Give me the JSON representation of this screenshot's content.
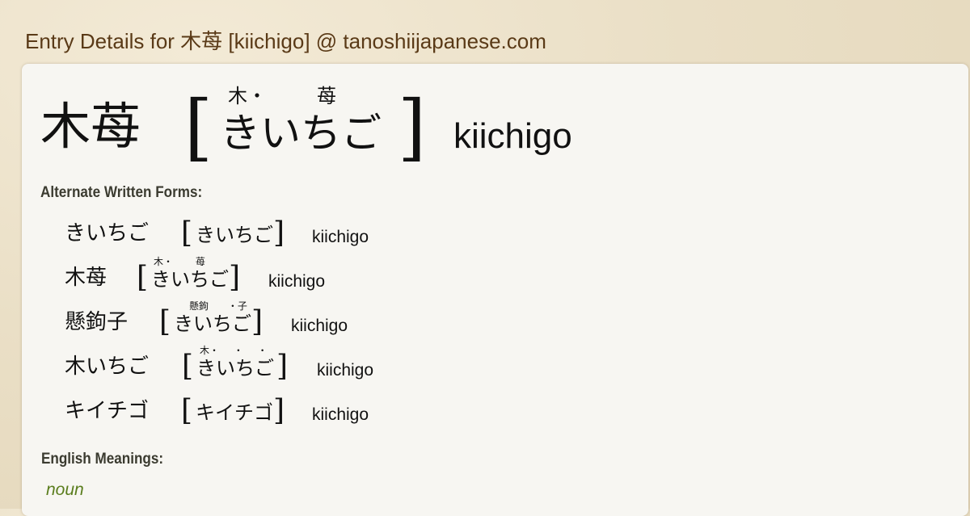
{
  "page": {
    "title": "Entry Details for 木苺 [kiichigo] @ tanoshiijapanese.com"
  },
  "entry": {
    "kanji": "木苺",
    "reading": "きいちご",
    "furigana": [
      "木・",
      "苺"
    ],
    "romaji": "kiichigo",
    "bracket_open": "[",
    "bracket_close": "]"
  },
  "alternate_forms": {
    "label": "Alternate Written Forms:",
    "items": [
      {
        "word": "きいちご",
        "reading": "きいちご",
        "furigana": "",
        "romaji": "kiichigo"
      },
      {
        "word": "木苺",
        "reading": "きいちご",
        "furigana": "木・ 苺",
        "romaji": "kiichigo"
      },
      {
        "word": "懸鉤子",
        "reading": "きいちご",
        "furigana": "懸鉤 ・子",
        "romaji": "kiichigo"
      },
      {
        "word": "木いちご",
        "reading": "きいちご",
        "furigana": "木・ ・ ・",
        "romaji": "kiichigo"
      },
      {
        "word": "キイチゴ",
        "reading": "キイチゴ",
        "furigana": "",
        "romaji": "kiichigo"
      }
    ]
  },
  "meanings": {
    "label": "English Meanings:",
    "part_of_speech": "noun"
  }
}
